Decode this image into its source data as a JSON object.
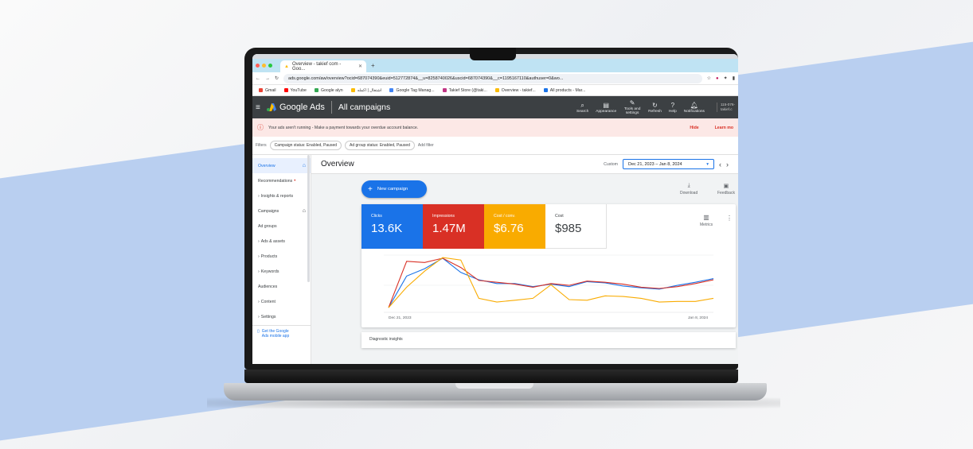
{
  "browser": {
    "tab_title": "Overview - takief com - Goo...",
    "url": "ads.google.com/aw/overview?ocid=687074390&euid=512772874&__u=8258740026&uscid=687074390&__c=1195167110&authuser=0&wo...",
    "bookmarks": [
      "Gmail",
      "YouTube",
      "Google alyn",
      "اشتغال | اكمله",
      "Google Tag Manag...",
      "Takief Store (@taki...",
      "Overview - takief...",
      "All products - Mar..."
    ]
  },
  "header": {
    "product": "Google Ads",
    "section": "All campaigns",
    "tools": [
      "Search",
      "Appearance",
      "Tools and settings",
      "Refresh",
      "Help",
      "Notifications"
    ],
    "account_line1": "115-076-",
    "account_line2": "takief.c"
  },
  "alert": {
    "message": "Your ads aren't running - Make a payment towards your overdue account balance.",
    "hide": "Hide",
    "learn": "Learn mo"
  },
  "filters": {
    "label": "Filters",
    "chips": [
      "Campaign status: Enabled, Paused",
      "Ad group status: Enabled, Paused"
    ],
    "add": "Add filter"
  },
  "sidebar": {
    "items": [
      {
        "label": "Overview",
        "active": true
      },
      {
        "label": "Recommendations"
      },
      {
        "label": "Insights & reports"
      },
      {
        "label": "Campaigns"
      },
      {
        "label": "Ad groups"
      },
      {
        "label": "Ads & assets"
      },
      {
        "label": "Products"
      },
      {
        "label": "Keywords"
      },
      {
        "label": "Audiences"
      },
      {
        "label": "Content"
      },
      {
        "label": "Settings"
      }
    ],
    "bottom": "Get the Google Ads mobile app"
  },
  "overview": {
    "title": "Overview",
    "custom_label": "Custom",
    "date_range": "Dec 21, 2023 – Jan 8, 2024",
    "new_campaign": "New campaign",
    "download": "Download",
    "feedback": "Feedback",
    "metrics_label": "Metrics",
    "bottom_card": "Diagnostic insights"
  },
  "metrics": [
    {
      "label": "Clicks",
      "value": "13.6K",
      "color": "#1a73e8"
    },
    {
      "label": "Impressions",
      "value": "1.47M",
      "color": "#d93025"
    },
    {
      "label": "Cost / conv.",
      "value": "$6.76",
      "color": "#f9ab00"
    },
    {
      "label": "Cost",
      "value": "$985",
      "color": "#ffffff"
    }
  ],
  "chart_data": {
    "type": "line",
    "x": [
      "Dec 21, 2023",
      "",
      "",
      "",
      "",
      "",
      "",
      "",
      "",
      "",
      "",
      "",
      "",
      "",
      "",
      "",
      "",
      "",
      "Jan 8, 2024"
    ],
    "series": [
      {
        "name": "Clicks",
        "color": "#1a73e8",
        "values": [
          5,
          56,
          68,
          85,
          62,
          50,
          44,
          44,
          39,
          43,
          39,
          47,
          45,
          40,
          37,
          35,
          41,
          46,
          52
        ]
      },
      {
        "name": "Impressions",
        "color": "#d93025",
        "values": [
          5,
          80,
          78,
          85,
          70,
          49,
          46,
          43,
          38,
          44,
          41,
          48,
          46,
          43,
          38,
          36,
          39,
          44,
          50
        ]
      },
      {
        "name": "Cost / conv.",
        "color": "#f9ab00",
        "values": [
          5,
          38,
          64,
          86,
          82,
          20,
          14,
          17,
          20,
          42,
          18,
          17,
          24,
          23,
          20,
          14,
          15,
          15,
          20
        ]
      }
    ]
  }
}
